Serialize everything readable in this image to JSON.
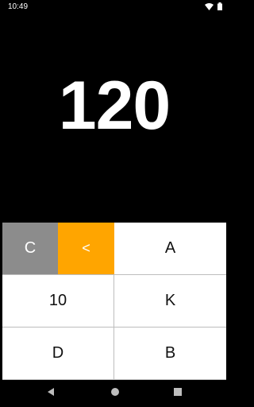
{
  "status_bar": {
    "time": "10:49"
  },
  "display": {
    "value": "120"
  },
  "keypad": {
    "clear": "C",
    "backspace": "<",
    "keys": [
      "A",
      "10",
      "K",
      "D",
      "B"
    ]
  },
  "colors": {
    "clear": "#8c8c8c",
    "backspace": "#ffa500",
    "background": "#000000"
  },
  "icons": {
    "wifi": "wifi-icon",
    "battery": "battery-icon",
    "back": "nav-back-icon",
    "home": "nav-home-icon",
    "recents": "nav-recents-icon"
  }
}
